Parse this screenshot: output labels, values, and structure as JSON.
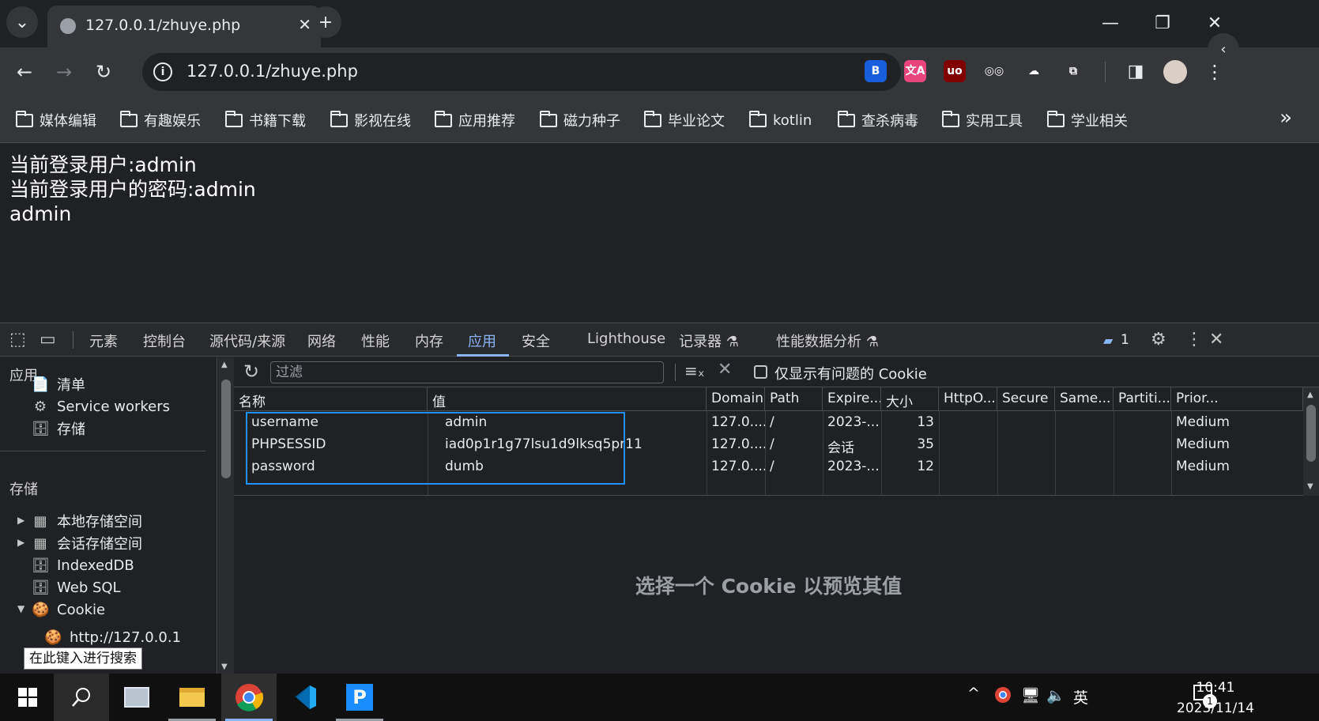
{
  "browser": {
    "tab": {
      "title": "127.0.0.1/zhuye.php",
      "close_glyph": "✕"
    },
    "tab_search_glyph": "⌄",
    "new_tab_glyph": "+",
    "window_controls": {
      "minimize": "—",
      "maximize": "❐",
      "close": "✕"
    },
    "side_panel_glyph": "‹",
    "nav": {
      "back": "←",
      "forward": "→",
      "reload": "↻"
    },
    "omnibox": {
      "info_glyph": "i",
      "url": "127.0.0.1/zhuye.php",
      "star": "☆"
    },
    "extensions": [
      {
        "name": "bitwarden-extension-icon",
        "glyph": "B",
        "color": "#175ddc"
      },
      {
        "name": "translate-extension-icon",
        "glyph": "文A",
        "color": "#e8457c"
      },
      {
        "name": "ublock-extension-icon",
        "glyph": "uo",
        "color": "#800000"
      },
      {
        "name": "glasses-extension-icon",
        "glyph": "◎◎",
        "color": "#35363a"
      },
      {
        "name": "cloud-extension-icon",
        "glyph": "☁",
        "color": "#35363a"
      },
      {
        "name": "puzzle-extension-icon",
        "glyph": "⧉",
        "color": "#35363a"
      }
    ],
    "menu_glyph": "⋮",
    "bookmarks": [
      "媒体编辑",
      "有趣娱乐",
      "书籍下载",
      "影视在线",
      "应用推荐",
      "磁力种子",
      "毕业论文",
      "kotlin",
      "查杀病毒",
      "实用工具",
      "学业相关"
    ],
    "bookmarks_more": "»"
  },
  "page": {
    "lines": [
      "当前登录用户:admin",
      "当前登录用户的密码:admin",
      "admin"
    ]
  },
  "devtools": {
    "tabs": [
      "元素",
      "控制台",
      "源代码/来源",
      "网络",
      "性能",
      "内存",
      "应用",
      "安全",
      "Lighthouse",
      "记录器 ⚗",
      "性能数据分析 ⚗"
    ],
    "active_tab": "应用",
    "issues_count": "1",
    "sidebar": {
      "section_app": "应用",
      "app_items": [
        {
          "label": "清单",
          "icon": "📄"
        },
        {
          "label": "Service workers",
          "icon": "⚙"
        },
        {
          "label": "存储",
          "icon": "🗄"
        }
      ],
      "section_storage": "存储",
      "storage_items": [
        {
          "label": "本地存储空间",
          "icon": "▦",
          "arrow": "▶"
        },
        {
          "label": "会话存储空间",
          "icon": "▦",
          "arrow": "▶"
        },
        {
          "label": "IndexedDB",
          "icon": "🗄",
          "arrow": ""
        },
        {
          "label": "Web SQL",
          "icon": "🗄",
          "arrow": ""
        },
        {
          "label": "Cookie",
          "icon": "🍪",
          "arrow": "▼"
        }
      ],
      "cookie_origin": "http://127.0.0.1",
      "tooltip": "在此键入进行搜索"
    },
    "cookies": {
      "filter_placeholder": "过滤",
      "only_issues_label": "仅显示有问题的 Cookie",
      "columns": [
        "名称",
        "值",
        "Domain",
        "Path",
        "Expire...",
        "大小",
        "HttpO...",
        "Secure",
        "Same...",
        "Partiti...",
        "Prior..."
      ],
      "rows": [
        {
          "name": "username",
          "value": "admin",
          "domain": "127.0....",
          "path": "/",
          "expires": "2023-...",
          "size": "13",
          "httponly": "",
          "secure": "",
          "samesite": "",
          "partition": "",
          "priority": "Medium"
        },
        {
          "name": "PHPSESSID",
          "value": "iad0p1r1g77lsu1d9lksq5pr11",
          "domain": "127.0....",
          "path": "/",
          "expires": "会话",
          "size": "35",
          "httponly": "",
          "secure": "",
          "samesite": "",
          "partition": "",
          "priority": "Medium"
        },
        {
          "name": "password",
          "value": "dumb",
          "domain": "127.0....",
          "path": "/",
          "expires": "2023-...",
          "size": "12",
          "httponly": "",
          "secure": "",
          "samesite": "",
          "partition": "",
          "priority": "Medium"
        }
      ],
      "preview_message": "选择一个 Cookie 以预览其值"
    }
  },
  "taskbar": {
    "time": "10:41",
    "date": "2023/11/14",
    "ime": "英",
    "notification_count": "1",
    "tray_up": "^"
  }
}
